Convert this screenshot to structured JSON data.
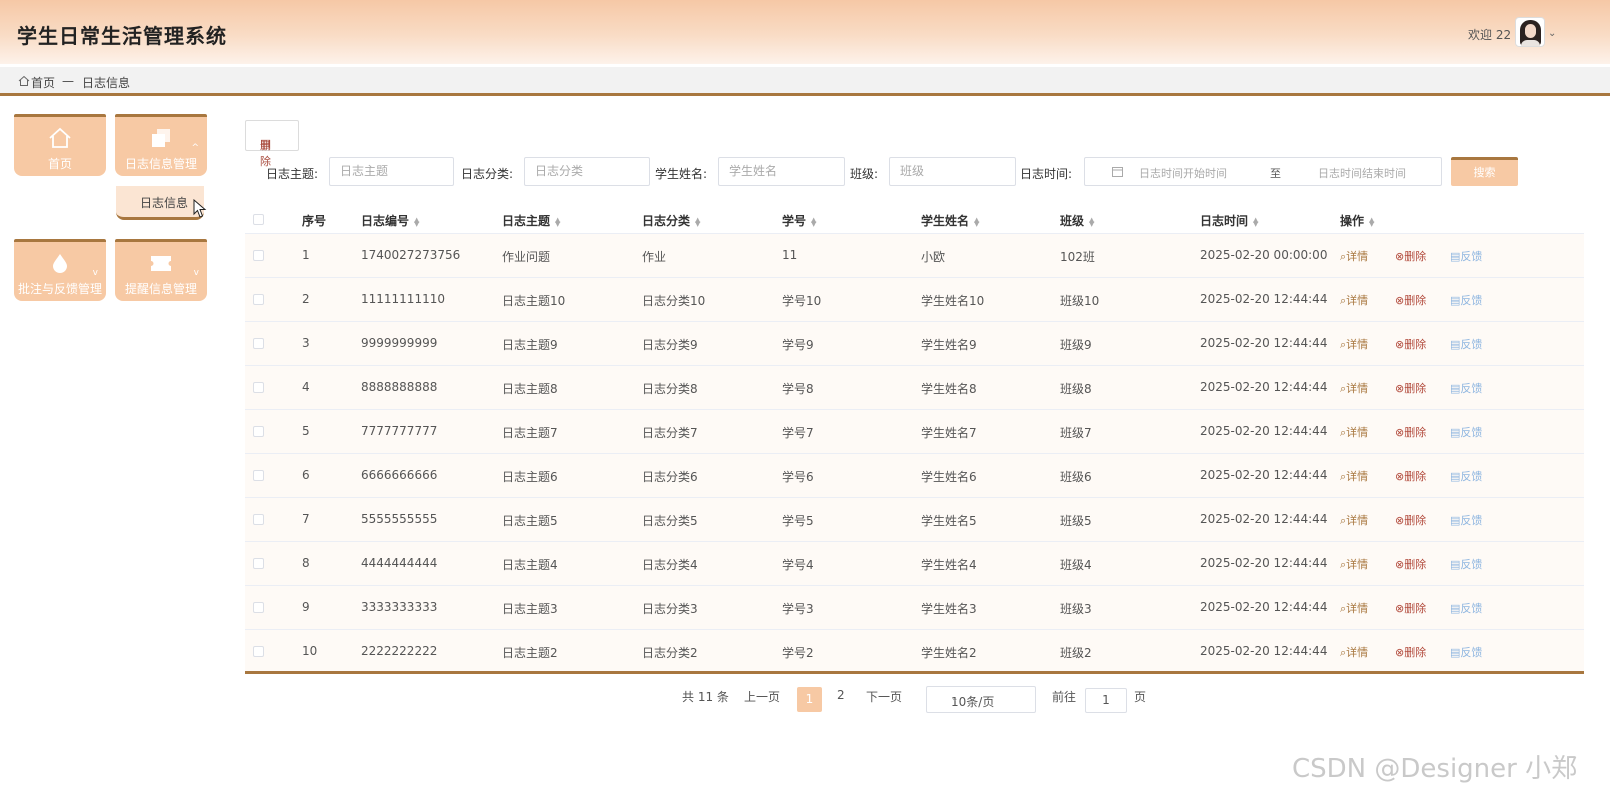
{
  "app": {
    "title": "学生日常生活管理系统",
    "welcome": "欢迎 22"
  },
  "breadcrumb": {
    "home": "首页",
    "sep": "—",
    "current": "日志信息"
  },
  "sidebar": {
    "items": [
      {
        "label": "首页",
        "icon": "home-icon"
      },
      {
        "label": "日志信息管理",
        "icon": "copy-icon",
        "caret": "^"
      },
      {
        "label": "批注与反馈管理",
        "icon": "drop-icon",
        "caret": "v"
      },
      {
        "label": "提醒信息管理",
        "icon": "ticket-icon",
        "caret": "v"
      }
    ],
    "submenu": {
      "label": "日志信息"
    }
  },
  "toolbar": {
    "delete_label": "删除",
    "search_button": "搜索"
  },
  "search": {
    "fields": [
      {
        "label": "日志主题:",
        "placeholder": "日志主题"
      },
      {
        "label": "日志分类:",
        "placeholder": "日志分类"
      },
      {
        "label": "学生姓名:",
        "placeholder": "学生姓名"
      },
      {
        "label": "班级:",
        "placeholder": "班级"
      }
    ],
    "date": {
      "label": "日志时间:",
      "start_placeholder": "日志时间开始时间",
      "separator": "至",
      "end_placeholder": "日志时间结束时间"
    }
  },
  "table": {
    "columns": [
      "序号",
      "日志编号",
      "日志主题",
      "日志分类",
      "学号",
      "学生姓名",
      "班级",
      "日志时间",
      "操作"
    ],
    "actions": {
      "detail": "详情",
      "delete": "删除",
      "feedback": "反馈"
    },
    "rows": [
      [
        "1",
        "1740027273756",
        "作业问题",
        "作业",
        "11",
        "小欧",
        "102班",
        "2025-02-20 00:00:00"
      ],
      [
        "2",
        "11111111110",
        "日志主题10",
        "日志分类10",
        "学号10",
        "学生姓名10",
        "班级10",
        "2025-02-20 12:44:44"
      ],
      [
        "3",
        "9999999999",
        "日志主题9",
        "日志分类9",
        "学号9",
        "学生姓名9",
        "班级9",
        "2025-02-20 12:44:44"
      ],
      [
        "4",
        "8888888888",
        "日志主题8",
        "日志分类8",
        "学号8",
        "学生姓名8",
        "班级8",
        "2025-02-20 12:44:44"
      ],
      [
        "5",
        "7777777777",
        "日志主题7",
        "日志分类7",
        "学号7",
        "学生姓名7",
        "班级7",
        "2025-02-20 12:44:44"
      ],
      [
        "6",
        "6666666666",
        "日志主题6",
        "日志分类6",
        "学号6",
        "学生姓名6",
        "班级6",
        "2025-02-20 12:44:44"
      ],
      [
        "7",
        "5555555555",
        "日志主题5",
        "日志分类5",
        "学号5",
        "学生姓名5",
        "班级5",
        "2025-02-20 12:44:44"
      ],
      [
        "8",
        "4444444444",
        "日志主题4",
        "日志分类4",
        "学号4",
        "学生姓名4",
        "班级4",
        "2025-02-20 12:44:44"
      ],
      [
        "9",
        "3333333333",
        "日志主题3",
        "日志分类3",
        "学号3",
        "学生姓名3",
        "班级3",
        "2025-02-20 12:44:44"
      ],
      [
        "10",
        "2222222222",
        "日志主题2",
        "日志分类2",
        "学号2",
        "学生姓名2",
        "班级2",
        "2025-02-20 12:44:44"
      ]
    ]
  },
  "pagination": {
    "total": "共 11 条",
    "prev": "上一页",
    "pages": [
      "1",
      "2"
    ],
    "current": "1",
    "next": "下一页",
    "page_size": "10条/页",
    "goto_label": "前往",
    "goto_value": "1",
    "goto_suffix": "页"
  },
  "watermark": "CSDN @Designer 小郑",
  "colors": {
    "accent": "#f7c9a4",
    "accent_border": "#a8773f",
    "delete": "#b24a3c",
    "feedback": "#8fb6e0"
  }
}
